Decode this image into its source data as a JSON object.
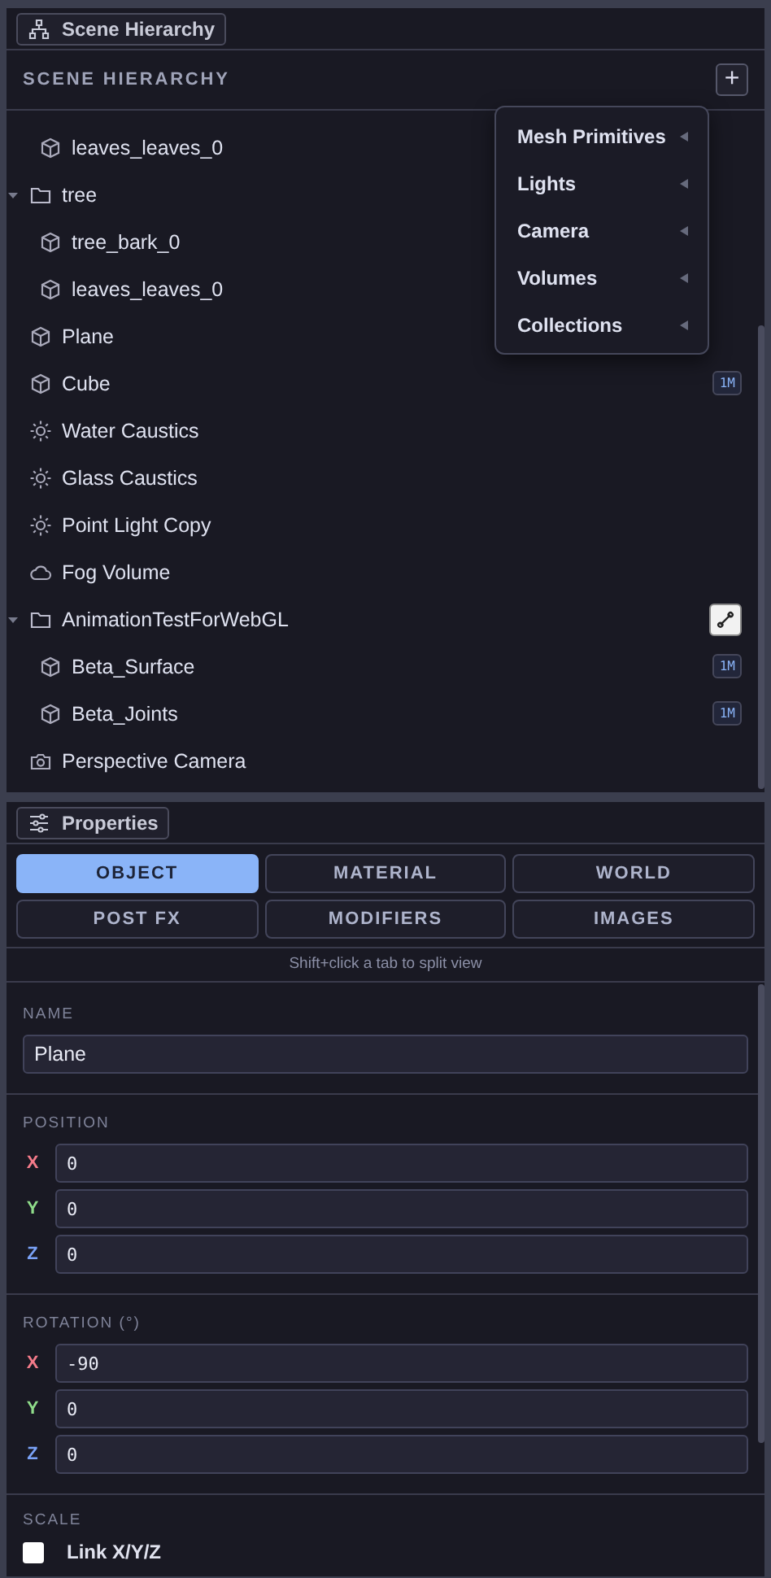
{
  "hierarchy_panel": {
    "tab_label": "Scene Hierarchy",
    "title": "SCENE HIERARCHY",
    "add_button": "+"
  },
  "tree": [
    {
      "children": [
        {
          "label": "leaves_leaves_0",
          "kind": "mesh"
        }
      ]
    },
    {
      "label": "tree",
      "kind": "folder",
      "expanded": true,
      "children": [
        {
          "label": "tree_bark_0",
          "kind": "mesh"
        },
        {
          "label": "leaves_leaves_0",
          "kind": "mesh"
        }
      ]
    },
    {
      "label": "Plane",
      "kind": "mesh"
    },
    {
      "label": "Cube",
      "kind": "mesh",
      "badge": "1M"
    },
    {
      "label": "Water Caustics",
      "kind": "light"
    },
    {
      "label": "Glass Caustics",
      "kind": "light"
    },
    {
      "label": "Point Light Copy",
      "kind": "light"
    },
    {
      "label": "Fog Volume",
      "kind": "volume"
    },
    {
      "label": "AnimationTestForWebGL",
      "kind": "folder",
      "expanded": true,
      "skeleton_button": true,
      "children": [
        {
          "label": "Beta_Surface",
          "kind": "mesh",
          "badge": "1M"
        },
        {
          "label": "Beta_Joints",
          "kind": "mesh",
          "badge": "1M"
        }
      ]
    },
    {
      "label": "Perspective Camera",
      "kind": "camera"
    }
  ],
  "add_menu": [
    "Mesh Primitives",
    "Lights",
    "Camera",
    "Volumes",
    "Collections"
  ],
  "properties_panel": {
    "tab_label": "Properties",
    "tabs": [
      {
        "label": "OBJECT",
        "selected": true
      },
      {
        "label": "MATERIAL",
        "selected": false
      },
      {
        "label": "WORLD",
        "selected": false
      },
      {
        "label": "POST FX",
        "selected": false
      },
      {
        "label": "MODIFIERS",
        "selected": false
      },
      {
        "label": "IMAGES",
        "selected": false
      }
    ],
    "hint": "Shift+click a tab to split view",
    "name_section": {
      "label": "NAME",
      "value": "Plane"
    },
    "vector_sections": [
      {
        "label": "POSITION",
        "fields": [
          {
            "axis": "X",
            "value": "0"
          },
          {
            "axis": "Y",
            "value": "0"
          },
          {
            "axis": "Z",
            "value": "0"
          }
        ]
      },
      {
        "label": "ROTATION (°)",
        "fields": [
          {
            "axis": "X",
            "value": "-90"
          },
          {
            "axis": "Y",
            "value": "0"
          },
          {
            "axis": "Z",
            "value": "0"
          }
        ]
      }
    ],
    "scale_section": {
      "label": "SCALE",
      "link_label": "Link X/Y/Z",
      "link_checked": false
    }
  }
}
